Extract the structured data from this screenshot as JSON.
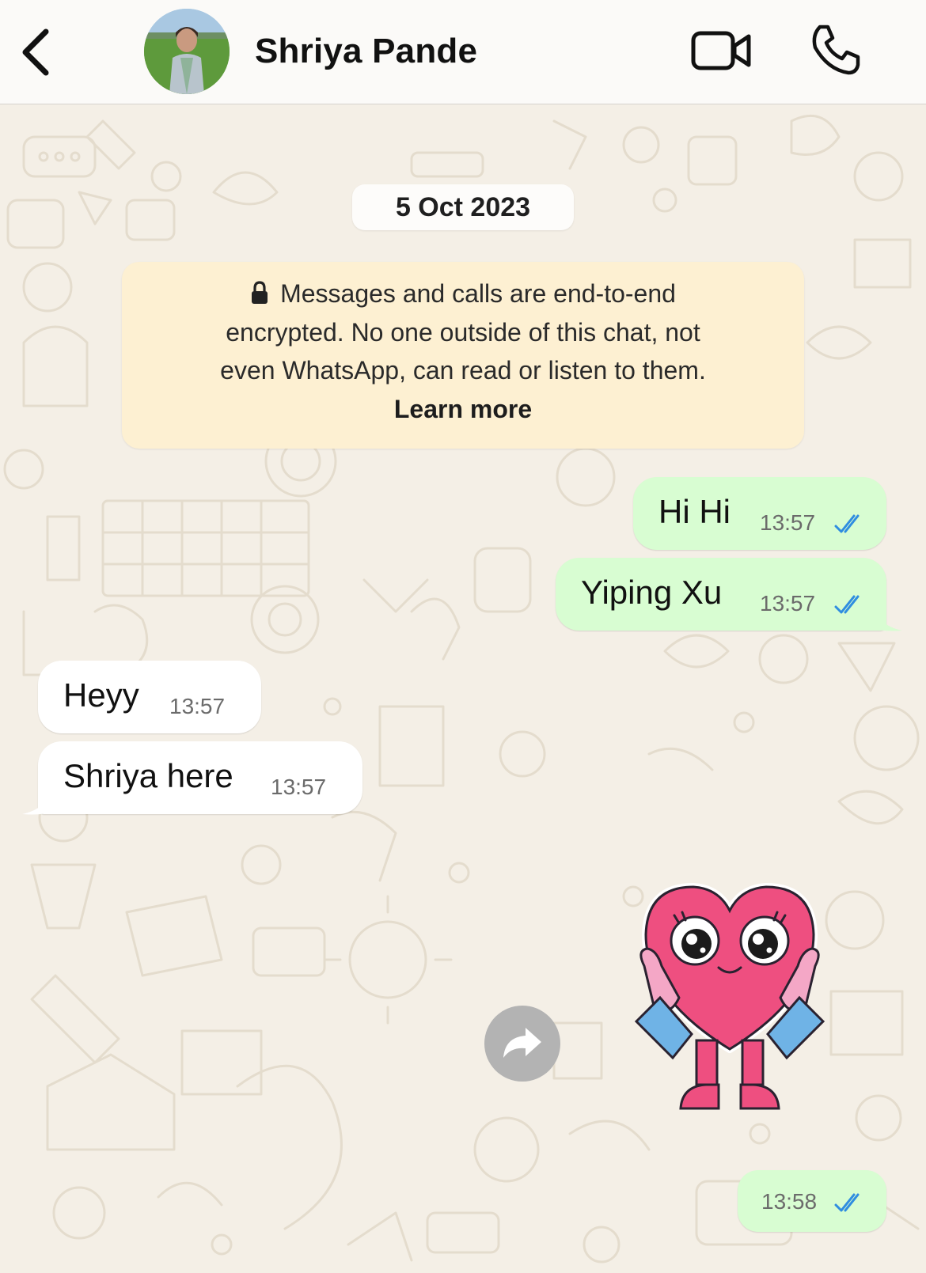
{
  "header": {
    "contact_name": "Shriya Pande",
    "icons": [
      "chevron-left-icon",
      "avatar",
      "video-camera-icon",
      "phone-icon"
    ]
  },
  "chat": {
    "date_separator": "5 Oct 2023",
    "encryption_notice": {
      "lines": [
        "Messages and calls are end-to-end",
        "encrypted. No one outside of this chat, not",
        "even WhatsApp, can read or listen to them."
      ],
      "link": "Learn more"
    },
    "messages": [
      {
        "direction": "outgoing",
        "text": "Hi Hi",
        "time": "13:57",
        "status": "read"
      },
      {
        "direction": "outgoing",
        "text": "Yiping Xu",
        "time": "13:57",
        "status": "read"
      },
      {
        "direction": "incoming",
        "text": "Heyy",
        "time": "13:57"
      },
      {
        "direction": "incoming",
        "text": "Shriya here",
        "time": "13:57"
      },
      {
        "direction": "outgoing",
        "type": "sticker",
        "sticker": "heart-character-sticker",
        "time": "13:58",
        "status": "read"
      }
    ]
  },
  "colors": {
    "outgoing_bubble": "#d8fdd2",
    "incoming_bubble": "#ffffff",
    "notice_bg": "#fdf0d2",
    "read_ticks": "#2f8de0",
    "wallpaper": "#f4efe6"
  }
}
